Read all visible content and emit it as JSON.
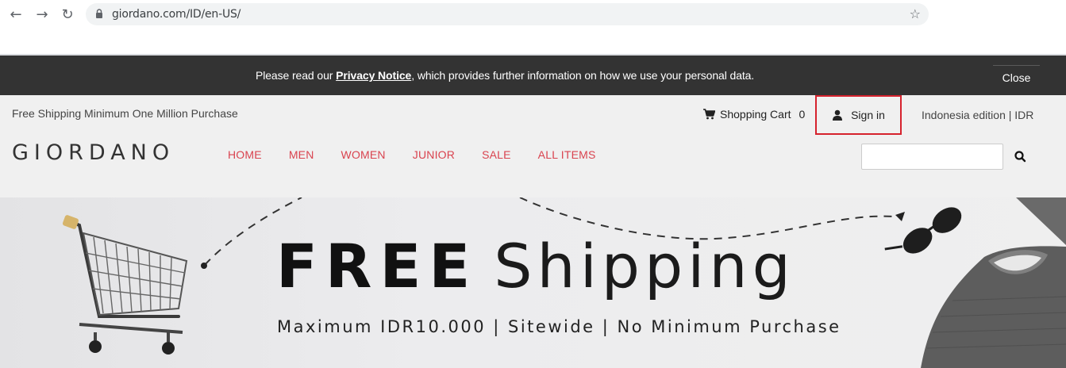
{
  "browser": {
    "url": "giordano.com/ID/en-US/",
    "back_icon": "←",
    "forward_icon": "→",
    "reload_icon": "↻",
    "star_icon": "☆"
  },
  "privacy_banner": {
    "text_before": "Please read our ",
    "link": "Privacy Notice",
    "text_after": ", which provides further information on how we use your personal data.",
    "close_label": "Close"
  },
  "header": {
    "promo": "Free Shipping Minimum One Million Purchase",
    "cart_label": "Shopping Cart",
    "cart_count": "0",
    "signin_label": "Sign in",
    "edition": "Indonesia edition | IDR",
    "logo": "GIORDANO",
    "nav": [
      "HOME",
      "MEN",
      "WOMEN",
      "JUNIOR",
      "SALE",
      "ALL ITEMS"
    ],
    "search_placeholder": ""
  },
  "hero": {
    "title_bold": "FREE",
    "title_light": "Shipping",
    "subtitle": "Maximum IDR10.000 | Sitewide | No Minimum Purchase"
  },
  "colors": {
    "nav_accent": "#d9434f",
    "banner_bg": "#333333",
    "highlight_border": "#d6222d"
  }
}
